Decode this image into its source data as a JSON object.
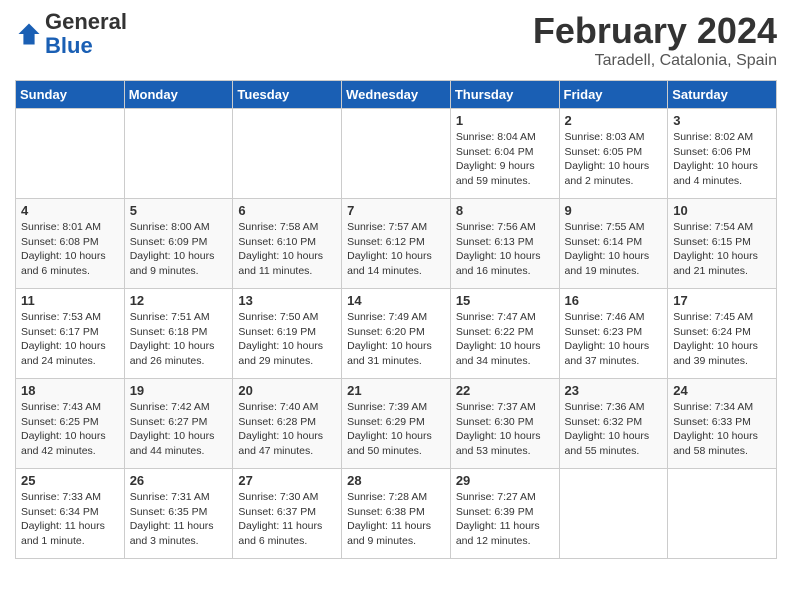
{
  "header": {
    "logo_general": "General",
    "logo_blue": "Blue",
    "title": "February 2024",
    "location": "Taradell, Catalonia, Spain"
  },
  "days_of_week": [
    "Sunday",
    "Monday",
    "Tuesday",
    "Wednesday",
    "Thursday",
    "Friday",
    "Saturday"
  ],
  "weeks": [
    [
      {
        "num": "",
        "info": ""
      },
      {
        "num": "",
        "info": ""
      },
      {
        "num": "",
        "info": ""
      },
      {
        "num": "",
        "info": ""
      },
      {
        "num": "1",
        "info": "Sunrise: 8:04 AM\nSunset: 6:04 PM\nDaylight: 9 hours and 59 minutes."
      },
      {
        "num": "2",
        "info": "Sunrise: 8:03 AM\nSunset: 6:05 PM\nDaylight: 10 hours and 2 minutes."
      },
      {
        "num": "3",
        "info": "Sunrise: 8:02 AM\nSunset: 6:06 PM\nDaylight: 10 hours and 4 minutes."
      }
    ],
    [
      {
        "num": "4",
        "info": "Sunrise: 8:01 AM\nSunset: 6:08 PM\nDaylight: 10 hours and 6 minutes."
      },
      {
        "num": "5",
        "info": "Sunrise: 8:00 AM\nSunset: 6:09 PM\nDaylight: 10 hours and 9 minutes."
      },
      {
        "num": "6",
        "info": "Sunrise: 7:58 AM\nSunset: 6:10 PM\nDaylight: 10 hours and 11 minutes."
      },
      {
        "num": "7",
        "info": "Sunrise: 7:57 AM\nSunset: 6:12 PM\nDaylight: 10 hours and 14 minutes."
      },
      {
        "num": "8",
        "info": "Sunrise: 7:56 AM\nSunset: 6:13 PM\nDaylight: 10 hours and 16 minutes."
      },
      {
        "num": "9",
        "info": "Sunrise: 7:55 AM\nSunset: 6:14 PM\nDaylight: 10 hours and 19 minutes."
      },
      {
        "num": "10",
        "info": "Sunrise: 7:54 AM\nSunset: 6:15 PM\nDaylight: 10 hours and 21 minutes."
      }
    ],
    [
      {
        "num": "11",
        "info": "Sunrise: 7:53 AM\nSunset: 6:17 PM\nDaylight: 10 hours and 24 minutes."
      },
      {
        "num": "12",
        "info": "Sunrise: 7:51 AM\nSunset: 6:18 PM\nDaylight: 10 hours and 26 minutes."
      },
      {
        "num": "13",
        "info": "Sunrise: 7:50 AM\nSunset: 6:19 PM\nDaylight: 10 hours and 29 minutes."
      },
      {
        "num": "14",
        "info": "Sunrise: 7:49 AM\nSunset: 6:20 PM\nDaylight: 10 hours and 31 minutes."
      },
      {
        "num": "15",
        "info": "Sunrise: 7:47 AM\nSunset: 6:22 PM\nDaylight: 10 hours and 34 minutes."
      },
      {
        "num": "16",
        "info": "Sunrise: 7:46 AM\nSunset: 6:23 PM\nDaylight: 10 hours and 37 minutes."
      },
      {
        "num": "17",
        "info": "Sunrise: 7:45 AM\nSunset: 6:24 PM\nDaylight: 10 hours and 39 minutes."
      }
    ],
    [
      {
        "num": "18",
        "info": "Sunrise: 7:43 AM\nSunset: 6:25 PM\nDaylight: 10 hours and 42 minutes."
      },
      {
        "num": "19",
        "info": "Sunrise: 7:42 AM\nSunset: 6:27 PM\nDaylight: 10 hours and 44 minutes."
      },
      {
        "num": "20",
        "info": "Sunrise: 7:40 AM\nSunset: 6:28 PM\nDaylight: 10 hours and 47 minutes."
      },
      {
        "num": "21",
        "info": "Sunrise: 7:39 AM\nSunset: 6:29 PM\nDaylight: 10 hours and 50 minutes."
      },
      {
        "num": "22",
        "info": "Sunrise: 7:37 AM\nSunset: 6:30 PM\nDaylight: 10 hours and 53 minutes."
      },
      {
        "num": "23",
        "info": "Sunrise: 7:36 AM\nSunset: 6:32 PM\nDaylight: 10 hours and 55 minutes."
      },
      {
        "num": "24",
        "info": "Sunrise: 7:34 AM\nSunset: 6:33 PM\nDaylight: 10 hours and 58 minutes."
      }
    ],
    [
      {
        "num": "25",
        "info": "Sunrise: 7:33 AM\nSunset: 6:34 PM\nDaylight: 11 hours and 1 minute."
      },
      {
        "num": "26",
        "info": "Sunrise: 7:31 AM\nSunset: 6:35 PM\nDaylight: 11 hours and 3 minutes."
      },
      {
        "num": "27",
        "info": "Sunrise: 7:30 AM\nSunset: 6:37 PM\nDaylight: 11 hours and 6 minutes."
      },
      {
        "num": "28",
        "info": "Sunrise: 7:28 AM\nSunset: 6:38 PM\nDaylight: 11 hours and 9 minutes."
      },
      {
        "num": "29",
        "info": "Sunrise: 7:27 AM\nSunset: 6:39 PM\nDaylight: 11 hours and 12 minutes."
      },
      {
        "num": "",
        "info": ""
      },
      {
        "num": "",
        "info": ""
      }
    ]
  ]
}
